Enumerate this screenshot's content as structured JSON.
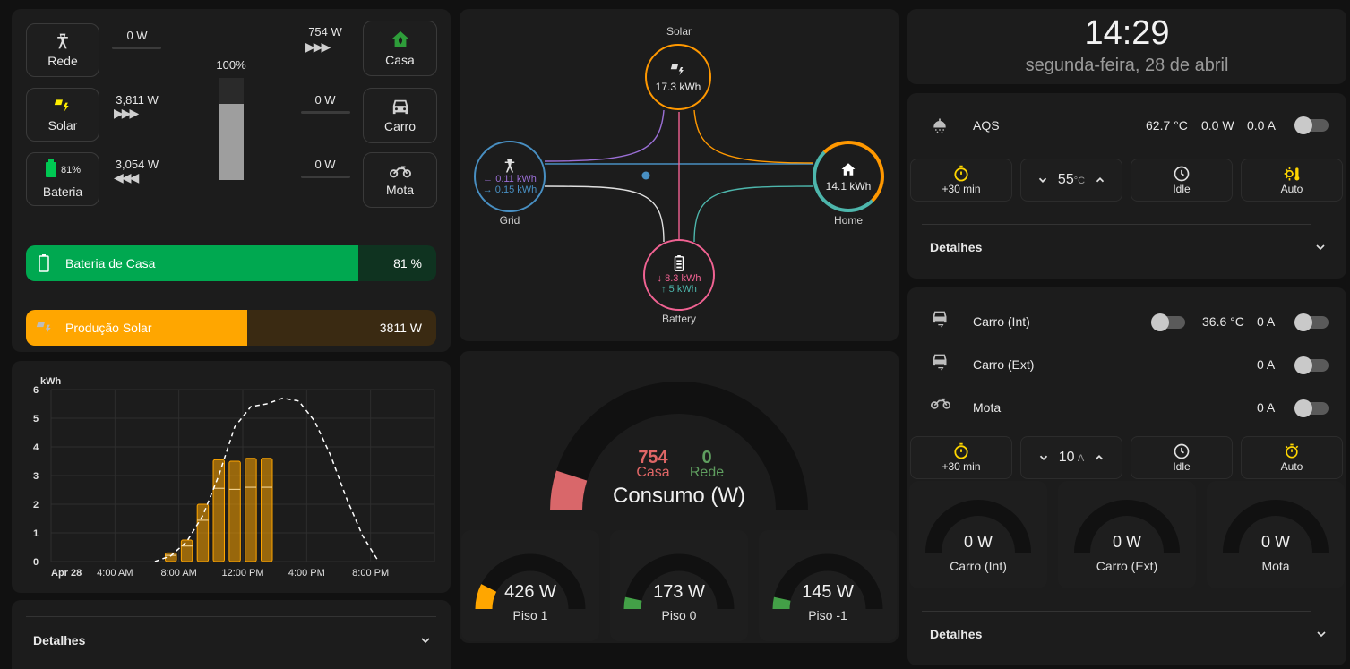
{
  "power_flow": {
    "grid": {
      "label": "Rede",
      "value": "0 W"
    },
    "solar": {
      "label": "Solar",
      "value": "3,811 W"
    },
    "battery": {
      "label": "Bateria",
      "value": "3,054 W",
      "percent": "81%"
    },
    "home": {
      "label": "Casa",
      "value": "754 W"
    },
    "car": {
      "label": "Carro",
      "value": "0 W"
    },
    "moto": {
      "label": "Mota",
      "value": "0 W"
    },
    "center_percent": "100%",
    "center_fill_fraction": 0.75
  },
  "bars": {
    "battery": {
      "label": "Bateria de Casa",
      "value": "81 %",
      "fraction": 0.81,
      "color": "#00a850"
    },
    "solar": {
      "label": "Produção Solar",
      "value": "3811 W",
      "fraction": 0.54,
      "color": "#ffa600"
    }
  },
  "chart_data": {
    "type": "bar",
    "ylabel": "kWh",
    "ylim": [
      0,
      6
    ],
    "yticks": [
      "0",
      "1",
      "2",
      "3",
      "4",
      "5",
      "6"
    ],
    "xticks": [
      "Apr 28",
      "4:00 AM",
      "8:00 AM",
      "12:00 PM",
      "4:00 PM",
      "8:00 PM"
    ],
    "x_hours": [
      7,
      8,
      9,
      10,
      11,
      12,
      13
    ],
    "values": [
      0.3,
      0.75,
      2.0,
      3.55,
      3.5,
      3.6,
      3.6
    ],
    "forecast_hours": [
      6,
      7,
      8,
      9,
      10,
      11,
      12,
      13,
      14,
      15,
      16,
      17,
      18,
      19,
      20
    ],
    "forecast": [
      0.0,
      0.2,
      0.7,
      1.6,
      3.0,
      4.7,
      5.4,
      5.5,
      5.7,
      5.6,
      4.9,
      3.7,
      2.2,
      0.9,
      0.0
    ],
    "color": "#ffa600"
  },
  "left_details": "Detalhes",
  "flow_card": {
    "solar": {
      "label": "Solar",
      "value": "17.3 kWh"
    },
    "grid": {
      "label": "Grid",
      "in": "← 0.11 kWh",
      "out": "→ 0.15 kWh"
    },
    "home": {
      "label": "Home",
      "value": "14.1 kWh"
    },
    "battery": {
      "label": "Battery",
      "in": "↓ 8.3 kWh",
      "out": "↑ 5 kWh"
    },
    "colors": {
      "solar": "#ff9800",
      "grid": "#488fc2",
      "home": "#ff9800",
      "battery": "#f06292"
    }
  },
  "consumo": {
    "title": "Consumo (W)",
    "casa_value": "754",
    "casa_label": "Casa",
    "rede_value": "0",
    "rede_label": "Rede",
    "fraction": 0.1
  },
  "floors": [
    {
      "value": "426 W",
      "label": "Piso 1",
      "fraction": 0.15,
      "color": "#ffa600"
    },
    {
      "value": "173 W",
      "label": "Piso 0",
      "fraction": 0.07,
      "color": "#43a047"
    },
    {
      "value": "145 W",
      "label": "Piso -1",
      "fraction": 0.07,
      "color": "#43a047"
    }
  ],
  "clock": {
    "time": "14:29",
    "date": "segunda-feira, 28 de abril"
  },
  "aqs": {
    "label": "AQS",
    "temp": "62.7 °C",
    "power": "0.0 W",
    "current": "0.0 A",
    "controls": {
      "boost": "+30 min",
      "setpoint": "55",
      "unit": "°C",
      "mode": "Idle",
      "auto": "Auto"
    },
    "details": "Detalhes"
  },
  "chargers": {
    "rows": [
      {
        "label": "Carro (Int)",
        "temp": "36.6 °C",
        "current": "0 A"
      },
      {
        "label": "Carro (Ext)",
        "current": "0 A"
      },
      {
        "label": "Mota",
        "current": "0 A"
      }
    ],
    "controls": {
      "boost": "+30 min",
      "setpoint": "10",
      "unit": "A",
      "mode": "Idle",
      "auto": "Auto"
    },
    "gauges": [
      {
        "value": "0 W",
        "label": "Carro (Int)"
      },
      {
        "value": "0 W",
        "label": "Carro (Ext)"
      },
      {
        "value": "0 W",
        "label": "Mota"
      }
    ],
    "details": "Detalhes"
  },
  "icons": [
    "transmission-tower-icon",
    "solar-panel-icon",
    "battery-icon",
    "home-leaf-icon",
    "car-icon",
    "motorbike-icon",
    "shower-icon",
    "timer-icon",
    "chevron-down-icon",
    "chevron-up-icon",
    "clock-icon",
    "sun-thermometer-icon"
  ]
}
